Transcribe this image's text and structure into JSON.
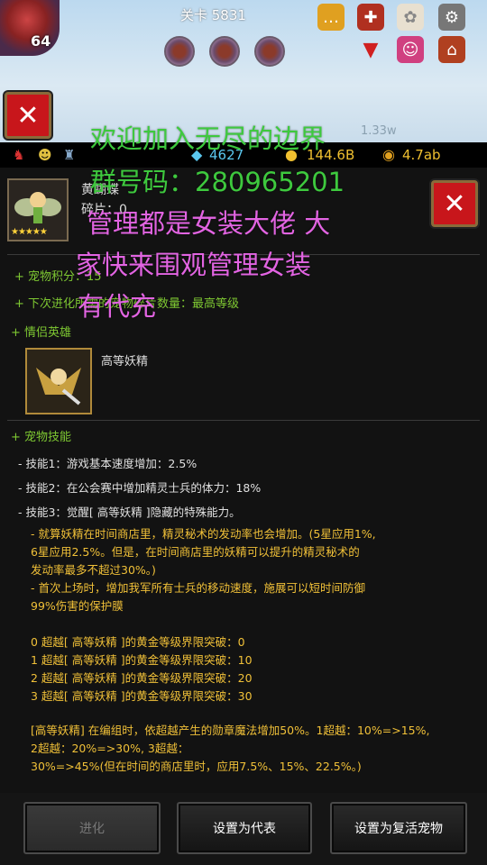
{
  "top_bar": {
    "level": "64",
    "stage": "关卡 5831"
  },
  "resources": {
    "gems": "4627",
    "gold": "144.6B",
    "coins": "4.7ab",
    "faded": "1.33w"
  },
  "pet": {
    "name": "黄蝴蝶",
    "sub": "碎片：0",
    "stars": "★★★★★"
  },
  "info": {
    "points": "+ 宠物积分：15",
    "next_evolve": "+ 下次进化所需的宠物碎片数量：最高等级",
    "partner_heading": "+ 情侣英雄",
    "partner_name": "高等妖精",
    "skills_heading": "+ 宠物技能"
  },
  "skills": [
    "- 技能1：游戏基本速度增加：2.5%",
    "- 技能2：在公会赛中增加精灵士兵的体力：18%",
    "- 技能3：觉醒[ 高等妖精 ]隐藏的特殊能力。"
  ],
  "description": [
    "- 就算妖精在时间商店里，精灵秘术的发动率也会增加。(5星应用1%,",
    "6星应用2.5%。但是，在时间商店里的妖精可以提升的精灵秘术的",
    "发动率最多不超过30%。)",
    "- 首次上场时，增加我军所有士兵的移动速度，施展可以短时间防御",
    "99%伤害的保护膜"
  ],
  "limit_break": [
    "0 超越[ 高等妖精 ]的黄金等级界限突破：0",
    "1 超越[ 高等妖精 ]的黄金等级界限突破：10",
    "2 超越[ 高等妖精 ]的黄金等级界限突破：20",
    "3 超越[ 高等妖精 ]的黄金等级界限突破：30"
  ],
  "bonus": [
    "[高等妖精] 在编组时，依超越产生的勋章魔法增加50%。1超越：10%=>15%,",
    "2超越：20%=>30%, 3超越：",
    "30%=>45%(但在时间的商店里时，应用7.5%、15%、22.5%。)"
  ],
  "buttons": {
    "evolve": "进化",
    "set_rep": "设置为代表",
    "set_revive": "设置为复活宠物"
  },
  "overlay": {
    "line1": "欢迎加入无尽的边界",
    "line2": "群号码：280965201",
    "line3": "管理都是女装大佬 大",
    "line4": "家快来围观管理女装",
    "line5": "有代充"
  },
  "colors": {
    "overlay_green": "#3ec93e",
    "overlay_pink": "#e264e2",
    "close_red": "#c8161b"
  }
}
